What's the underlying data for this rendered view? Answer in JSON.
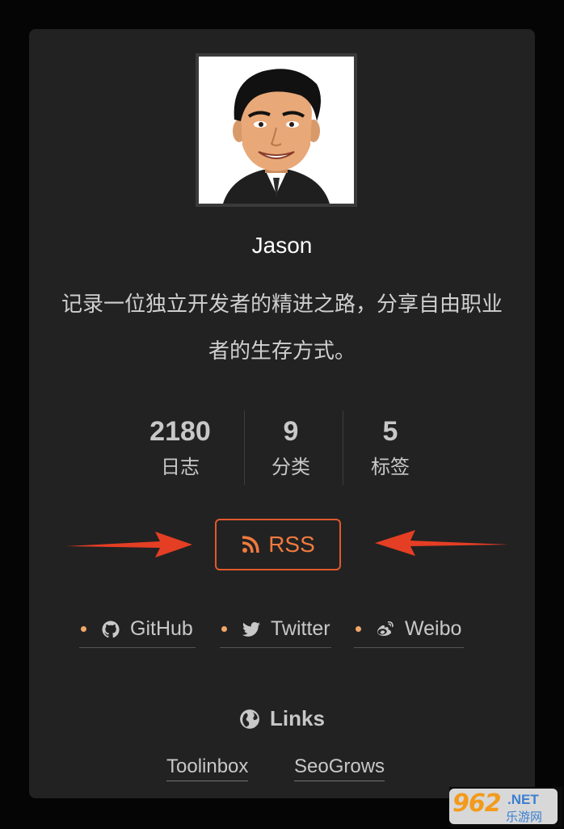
{
  "author": {
    "name": "Jason",
    "bio_line1": "记录一位独立开发者的精进之路，分享自由职业",
    "bio_line2": "者的生存方式。"
  },
  "stats": [
    {
      "count": "2180",
      "label": "日志"
    },
    {
      "count": "9",
      "label": "分类"
    },
    {
      "count": "5",
      "label": "标签"
    }
  ],
  "rss": {
    "label": "RSS",
    "icon": "rss-icon"
  },
  "social": [
    {
      "label": "GitHub",
      "icon": "github-icon"
    },
    {
      "label": "Twitter",
      "icon": "twitter-icon"
    },
    {
      "label": "Weibo",
      "icon": "weibo-icon"
    }
  ],
  "links": {
    "title": "Links",
    "icon": "globe-icon",
    "items": [
      "Toolinbox",
      "SeoGrows"
    ]
  },
  "watermark": {
    "number": "962",
    "suffix": ".NET",
    "cn": "乐游网"
  },
  "colors": {
    "background": "#050505",
    "card": "#222222",
    "accent": "#e15a2c",
    "arrow": "#e43e24",
    "dot": "#f0a868"
  }
}
